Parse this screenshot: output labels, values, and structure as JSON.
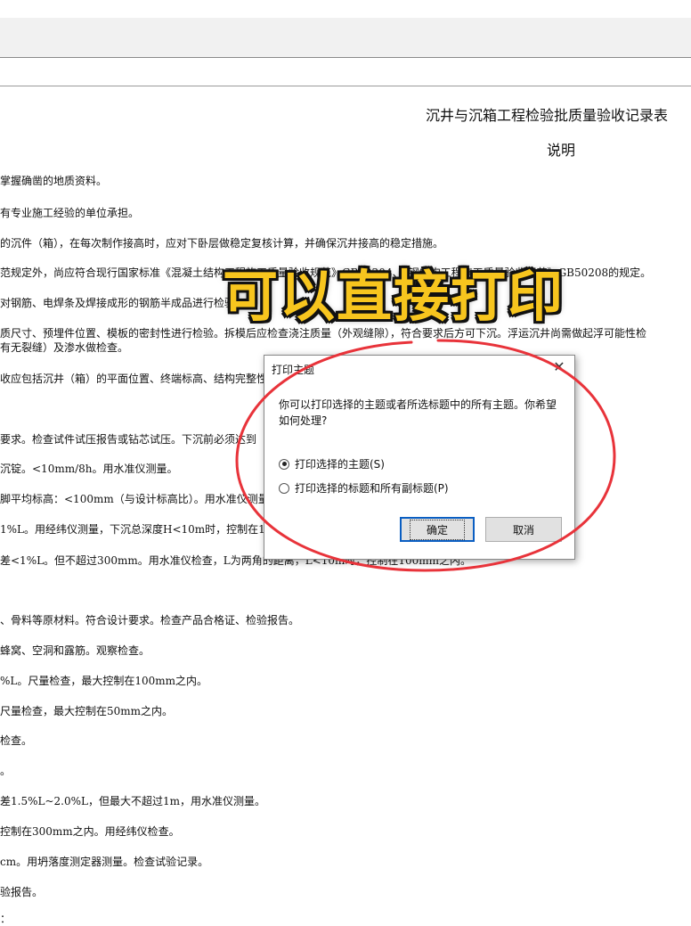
{
  "document": {
    "title": "沉井与沉箱工程检验批质量验收记录表",
    "subtitle": "说明",
    "lines": [
      "掌握确凿的地质资料。",
      "有专业施工经验的单位承担。",
      "的沉件（箱），在每次制作接高时，应对下卧层做稳定复核计算，并确保沉井接高的稳定措施。",
      "范规定外，尚应符合现行国家标准《混凝土结构工程施工质量验收规范》GB50204、《钢结构工程施工质量验收规范》GB50208的规定。",
      "对钢筋、电焊条及焊接成形的钢筋半成品进行检验。",
      "质尺寸、预埋件位置、模板的密封性进行检验。拆模后应检查浇注质量（外观缝隙），符合要求后方可下沉。浮运沉井尚需做起浮可能性检",
      "有无裂缝）及渗水做检查。",
      "收应包括沉井（箱）的平面位置、终端标高、结构完整性",
      "要求。检查试件试压报告或钻芯试压。下沉前必须达到",
      "沉锭。<10mm/8h。用水准仪测量。",
      "脚平均标高：<100mm（与设计标高比）。用水准仪测量",
      "1%L。用经纬仪测量，下沉总深度H<10m时，控制在1",
      "差<1%L。但不超过300mm。用水准仪检查，L为两角的距离，L<10m时，控制在100mm之内。",
      "、骨料等原材料。符合设计要求。检查产品合格证、检验报告。",
      "蜂窝、空洞和露筋。观察检查。",
      "%L。尺量检查，最大控制在100mm之内。",
      "尺量检查，最大控制在50mm之内。",
      "检查。",
      "。",
      "差1.5%L~2.0%L，但最大不超过1m，用水准仪测量。",
      "控制在300mm之内。用经纬仪检查。",
      "cm。用坍落度测定器测量。检查试验记录。",
      "验报告。",
      "："
    ]
  },
  "overlay": {
    "caption": "可以直接打印",
    "color": "#f7c51e"
  },
  "dialog": {
    "title": "打印主题",
    "message": "你可以打印选择的主题或者所选标题中的所有主题。你希望如何处理?",
    "options": [
      {
        "label": "打印选择的主题(S)",
        "selected": true
      },
      {
        "label": "打印选择的标题和所有副标题(P)",
        "selected": false
      }
    ],
    "ok_label": "确定",
    "cancel_label": "取消",
    "accent_color": "#0a5ec2"
  },
  "annotation": {
    "color": "#e8333a",
    "icon": "red-ellipse-annotation"
  }
}
